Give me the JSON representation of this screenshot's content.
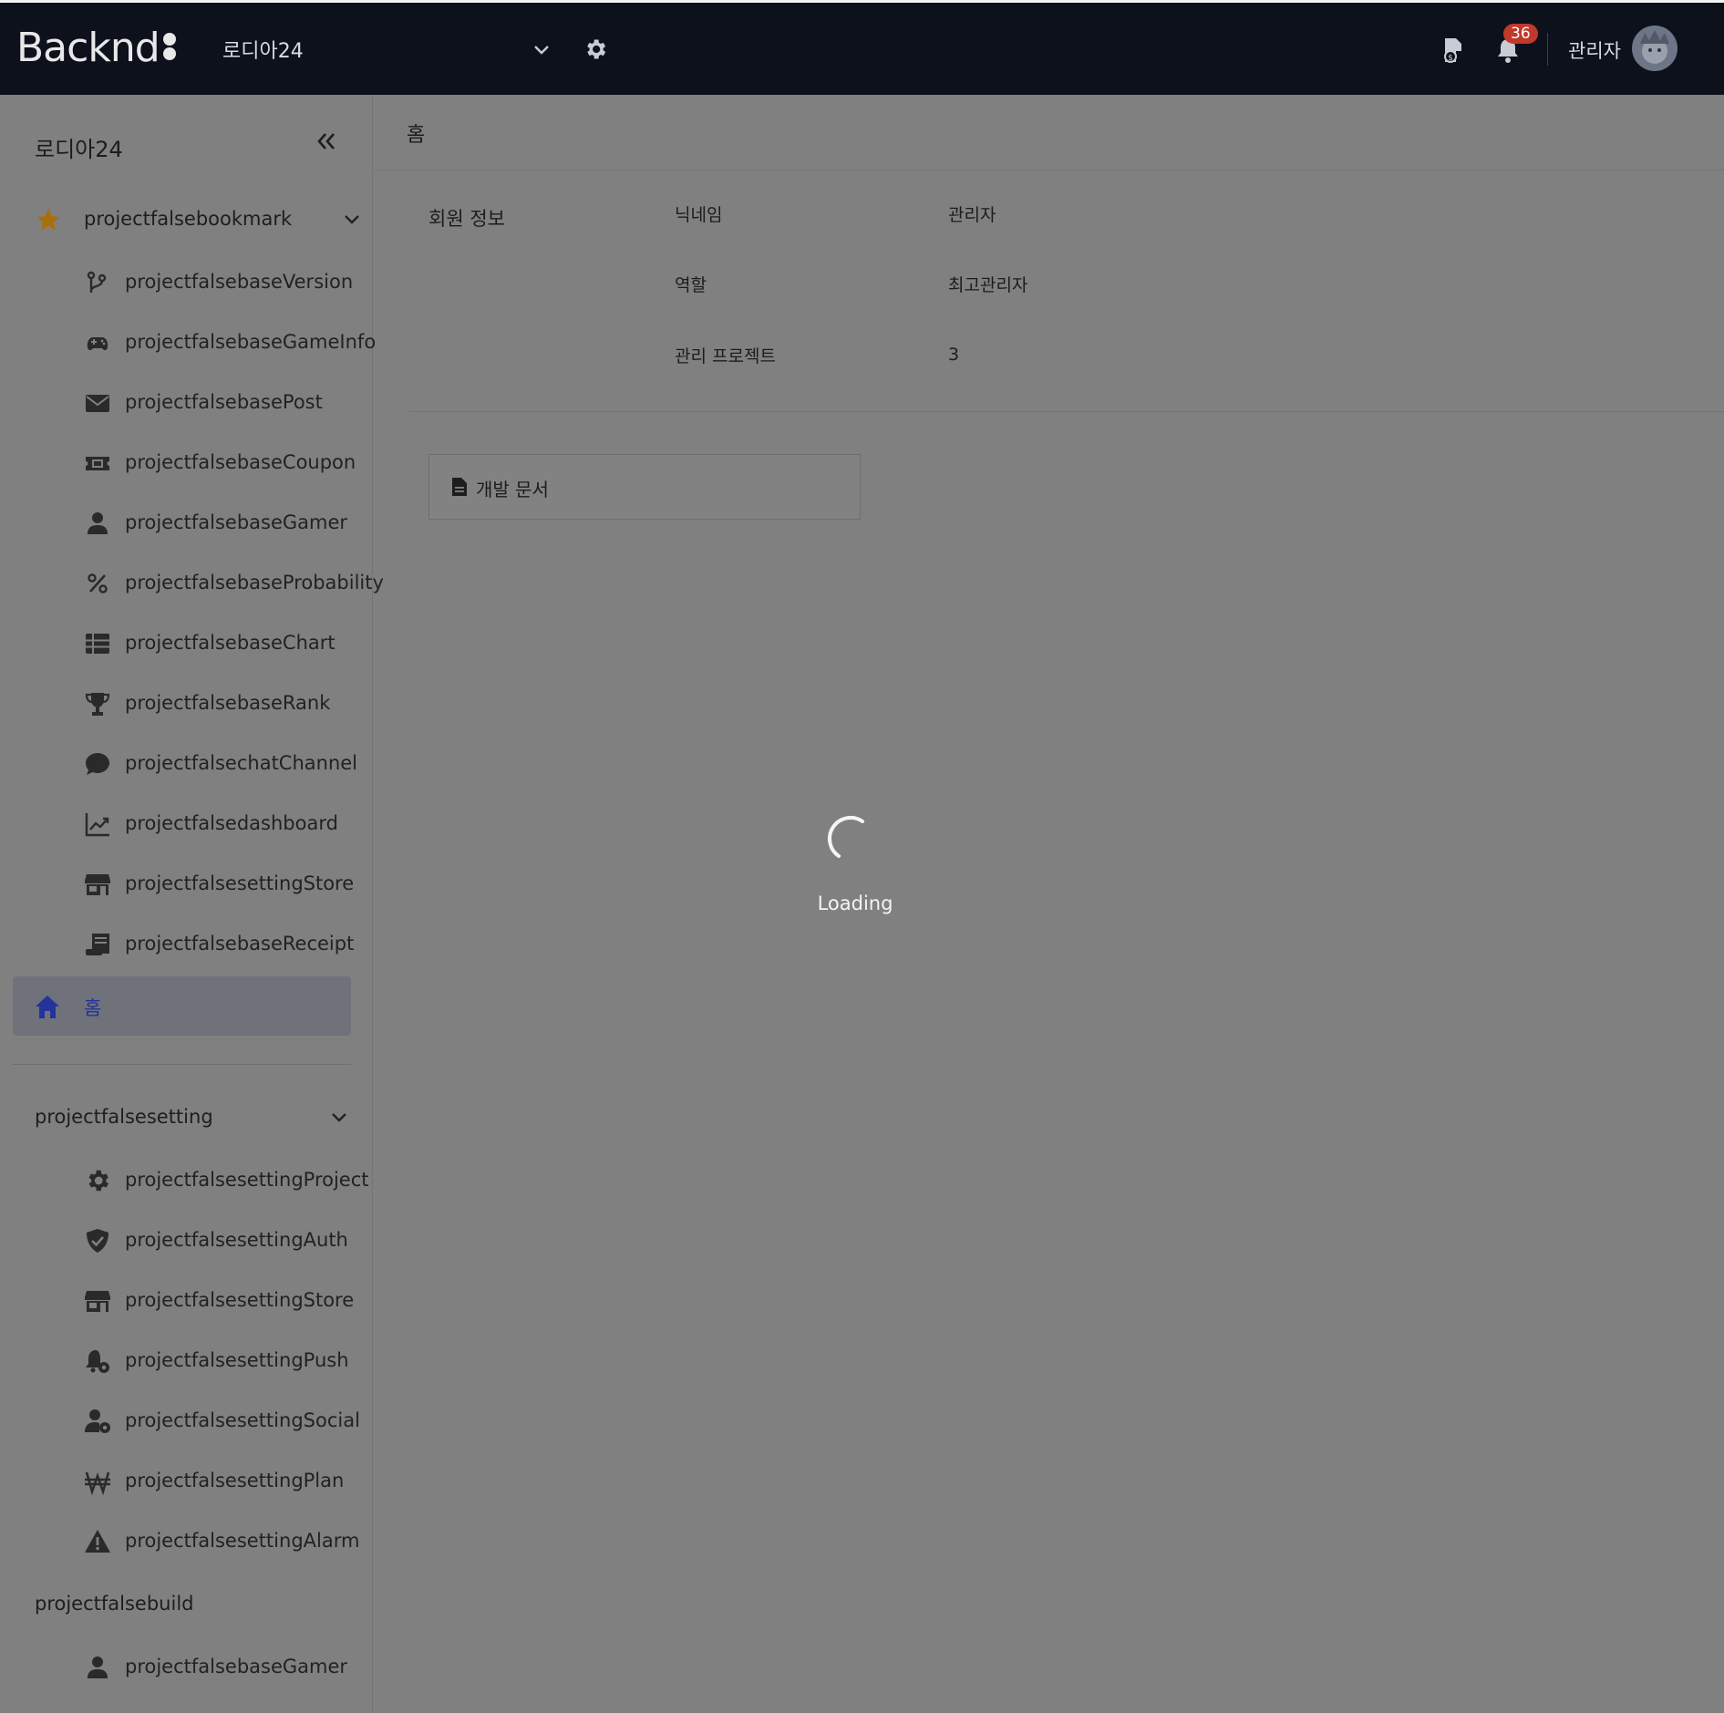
{
  "app": {
    "logo_text": "Backnd",
    "project_name": "로디아24",
    "notification_count": "36",
    "user_name": "관리자"
  },
  "sidebar": {
    "title": "로디아24",
    "bookmark_group": {
      "label": "projectfalsebookmark",
      "items": [
        {
          "label": "projectfalsebaseVersion",
          "icon": "branch-icon"
        },
        {
          "label": "projectfalsebaseGameInfo",
          "icon": "gamepad-icon"
        },
        {
          "label": "projectfalsebasePost",
          "icon": "envelope-icon"
        },
        {
          "label": "projectfalsebaseCoupon",
          "icon": "ticket-icon"
        },
        {
          "label": "projectfalsebaseGamer",
          "icon": "user-icon"
        },
        {
          "label": "projectfalsebaseProbability",
          "icon": "percent-icon"
        },
        {
          "label": "projectfalsebaseChart",
          "icon": "table-list-icon"
        },
        {
          "label": "projectfalsebaseRank",
          "icon": "trophy-icon"
        },
        {
          "label": "projectfalsechatChannel",
          "icon": "chat-bubble-icon"
        },
        {
          "label": "projectfalsedashboard",
          "icon": "line-chart-icon"
        },
        {
          "label": "projectfalsesettingStore",
          "icon": "store-icon"
        },
        {
          "label": "projectfalsebaseReceipt",
          "icon": "receipt-icon"
        }
      ]
    },
    "home": {
      "label": "홈",
      "icon": "home-icon"
    },
    "setting_group": {
      "label": "projectfalsesetting",
      "items": [
        {
          "label": "projectfalsesettingProject",
          "icon": "gear-icon"
        },
        {
          "label": "projectfalsesettingAuth",
          "icon": "shield-check-icon"
        },
        {
          "label": "projectfalsesettingStore",
          "icon": "store-icon"
        },
        {
          "label": "projectfalsesettingPush",
          "icon": "bell-gear-icon"
        },
        {
          "label": "projectfalsesettingSocial",
          "icon": "user-gear-icon"
        },
        {
          "label": "projectfalsesettingPlan",
          "icon": "won-icon"
        },
        {
          "label": "projectfalsesettingAlarm",
          "icon": "warning-icon"
        }
      ]
    },
    "build_group": {
      "label": "projectfalsebuild",
      "items": [
        {
          "label": "projectfalsebaseGamer",
          "icon": "user-icon"
        }
      ]
    }
  },
  "main": {
    "title": "홈",
    "member_info": {
      "section_label": "회원 정보",
      "rows": [
        {
          "key": "닉네임",
          "value": "관리자"
        },
        {
          "key": "역할",
          "value": "최고관리자"
        },
        {
          "key": "관리 프로젝트",
          "value": "3"
        }
      ]
    },
    "dev_docs_label": "개발 문서",
    "loading_text": "Loading"
  },
  "colors": {
    "topbar": "#0d111b",
    "overlay": "#808080",
    "badge": "#c0392b",
    "home_active_bg": "#6f727b",
    "home_active_text": "#22349a",
    "bookmark_star": "#a86f0a"
  }
}
